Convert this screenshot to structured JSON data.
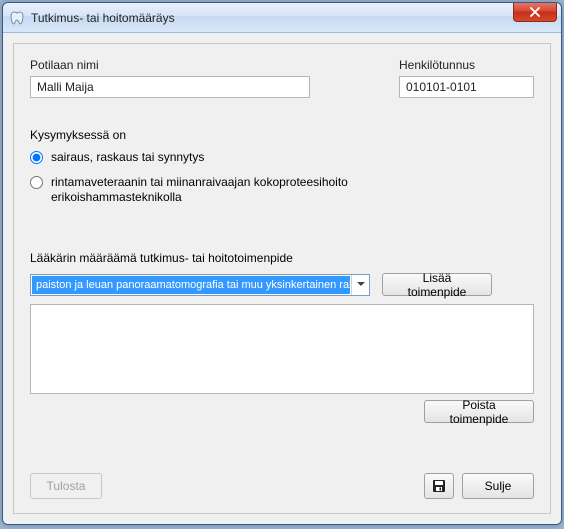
{
  "window": {
    "title": "Tutkimus- tai hoitomääräys"
  },
  "patient": {
    "name_label": "Potilaan nimi",
    "name_value": "Malli Maija",
    "id_label": "Henkilötunnus",
    "id_value": "010101-0101"
  },
  "question": {
    "label": "Kysymyksessä on",
    "options": [
      {
        "text": "sairaus, raskaus tai synnytys",
        "checked": true
      },
      {
        "text": "rintamaveteraanin tai miinanraivaajan kokoproteesihoito erikoishammasteknikolla",
        "checked": false
      }
    ]
  },
  "procedure": {
    "label": "Lääkärin määräämä tutkimus- tai hoitotoimenpide",
    "selected": "paiston ja leuan panoraamatomografia tai muu yksinkertainen rakokuvaus",
    "add_label": "Lisää toimenpide",
    "remove_label": "Poista toimenpide"
  },
  "footer": {
    "print_label": "Tulosta",
    "close_label": "Sulje"
  },
  "icons": {
    "app": "tooth-icon",
    "close": "close-icon",
    "save": "floppy-icon",
    "dropdown": "chevron-down-icon"
  }
}
